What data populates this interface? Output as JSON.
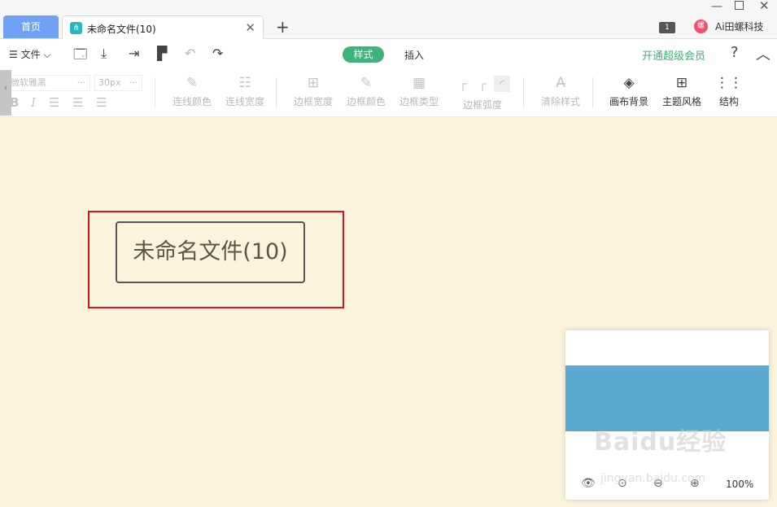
{
  "tabs": {
    "home_label": "首页",
    "document_label": "未命名文件(10)",
    "close_glyph": "✕",
    "add_glyph": "+"
  },
  "window": {
    "notification_count": "1",
    "user_name": "Ai田螺科技",
    "avatar_glyph": "螺"
  },
  "toolbar": {
    "file_menu_label": "文件",
    "style_tab_label": "样式",
    "insert_tab_label": "插入",
    "vip_link_label": "开通超级会员",
    "help_glyph": "?"
  },
  "format_ribbon": {
    "font_family_value": "微软雅黑",
    "font_size_value": "30px",
    "more_glyph": "···",
    "buttons": {
      "line_color": "连线颜色",
      "line_width": "连线宽度",
      "border_width": "边框宽度",
      "border_color": "边框颜色",
      "border_type": "边框类型",
      "border_radius": "边框弧度",
      "clear_style": "清除样式",
      "canvas_background": "画布背景",
      "theme_style": "主题风格",
      "structure": "结构"
    }
  },
  "canvas": {
    "central_topic": "未命名文件(10)",
    "background_color": "#fbf4dd",
    "highlight_color": "#e0101a"
  },
  "minimap": {
    "zoom_level": "100%",
    "viewport_color": "#5ba9cf"
  },
  "watermark": {
    "brand": "Baidu经验",
    "url": "jingyan.baidu.com"
  },
  "colors": {
    "accent_green": "#3fb37a",
    "home_tab_blue": "#6fa1f5"
  }
}
